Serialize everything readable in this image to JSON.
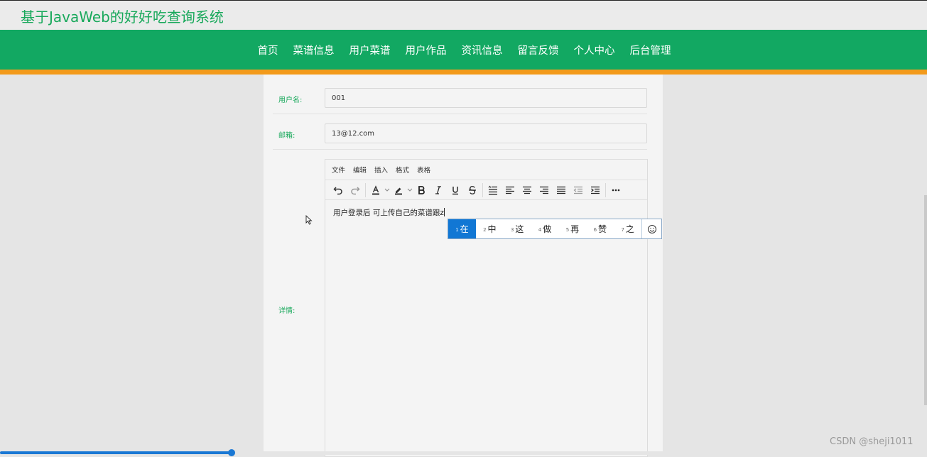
{
  "site": {
    "title": "基于JavaWeb的好好吃查询系统"
  },
  "nav": {
    "items": [
      "首页",
      "菜谱信息",
      "用户菜谱",
      "用户作品",
      "资讯信息",
      "留言反馈",
      "个人中心",
      "后台管理"
    ]
  },
  "form": {
    "username_label": "用户名:",
    "username_value": "001",
    "email_label": "邮箱:",
    "email_value": "13@12.com",
    "detail_label": "详情:"
  },
  "editor": {
    "menu": [
      "文件",
      "编辑",
      "插入",
      "格式",
      "表格"
    ],
    "content_text": "用户登录后  可上传自己的菜谱跟z"
  },
  "ime": {
    "candidates": [
      {
        "num": "1",
        "char": "在"
      },
      {
        "num": "2",
        "char": "中"
      },
      {
        "num": "3",
        "char": "这"
      },
      {
        "num": "4",
        "char": "做"
      },
      {
        "num": "5",
        "char": "再"
      },
      {
        "num": "6",
        "char": "赞"
      },
      {
        "num": "7",
        "char": "之"
      }
    ],
    "selected_index": 0
  },
  "watermark": "CSDN @sheji1011",
  "progress": {
    "fraction": 0.25
  },
  "colors": {
    "brand_green": "#12a862",
    "accent_orange": "#f39a1b",
    "ime_selected": "#1177d4"
  }
}
